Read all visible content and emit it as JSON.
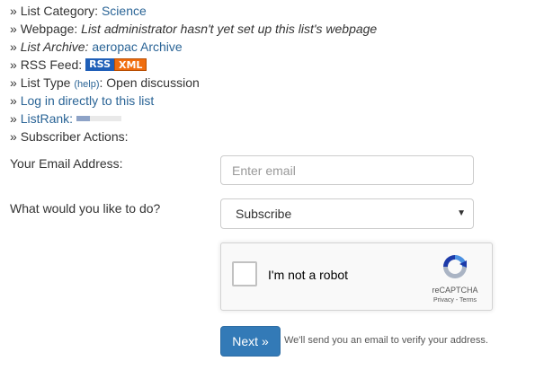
{
  "info": {
    "raquo": "»",
    "category_label": "List Category:",
    "category_value": "Science",
    "webpage_label": "Webpage:",
    "webpage_value": "List administrator hasn't yet set up this list's webpage",
    "archive_label": "List Archive:",
    "archive_value": "aeropac Archive",
    "rss_label": "RSS Feed:",
    "rss_badge": "RSS",
    "xml_badge": "XML",
    "type_label": "List Type",
    "type_help": "(help)",
    "type_value": "Open discussion",
    "login_link": "Log in directly to this list",
    "listrank_label": "ListRank:",
    "listrank_fraction": 0.3,
    "subscriber_actions": "Subscriber Actions:"
  },
  "form": {
    "email_label": "Your Email Address:",
    "email_placeholder": "Enter email",
    "email_value": "",
    "action_label": "What would you like to do?",
    "action_selected": "Subscribe",
    "caret": "▼"
  },
  "recaptcha": {
    "checkbox_text": "I'm not a robot",
    "brand": "reCAPTCHA",
    "terms": "Privacy - Terms"
  },
  "submit": {
    "next_label": "Next »",
    "note": "We'll send you an email to verify your address."
  },
  "colors": {
    "link": "#2a6496",
    "button": "#337ab7",
    "rss": "#1f5fb8",
    "xml": "#f06d0e"
  }
}
